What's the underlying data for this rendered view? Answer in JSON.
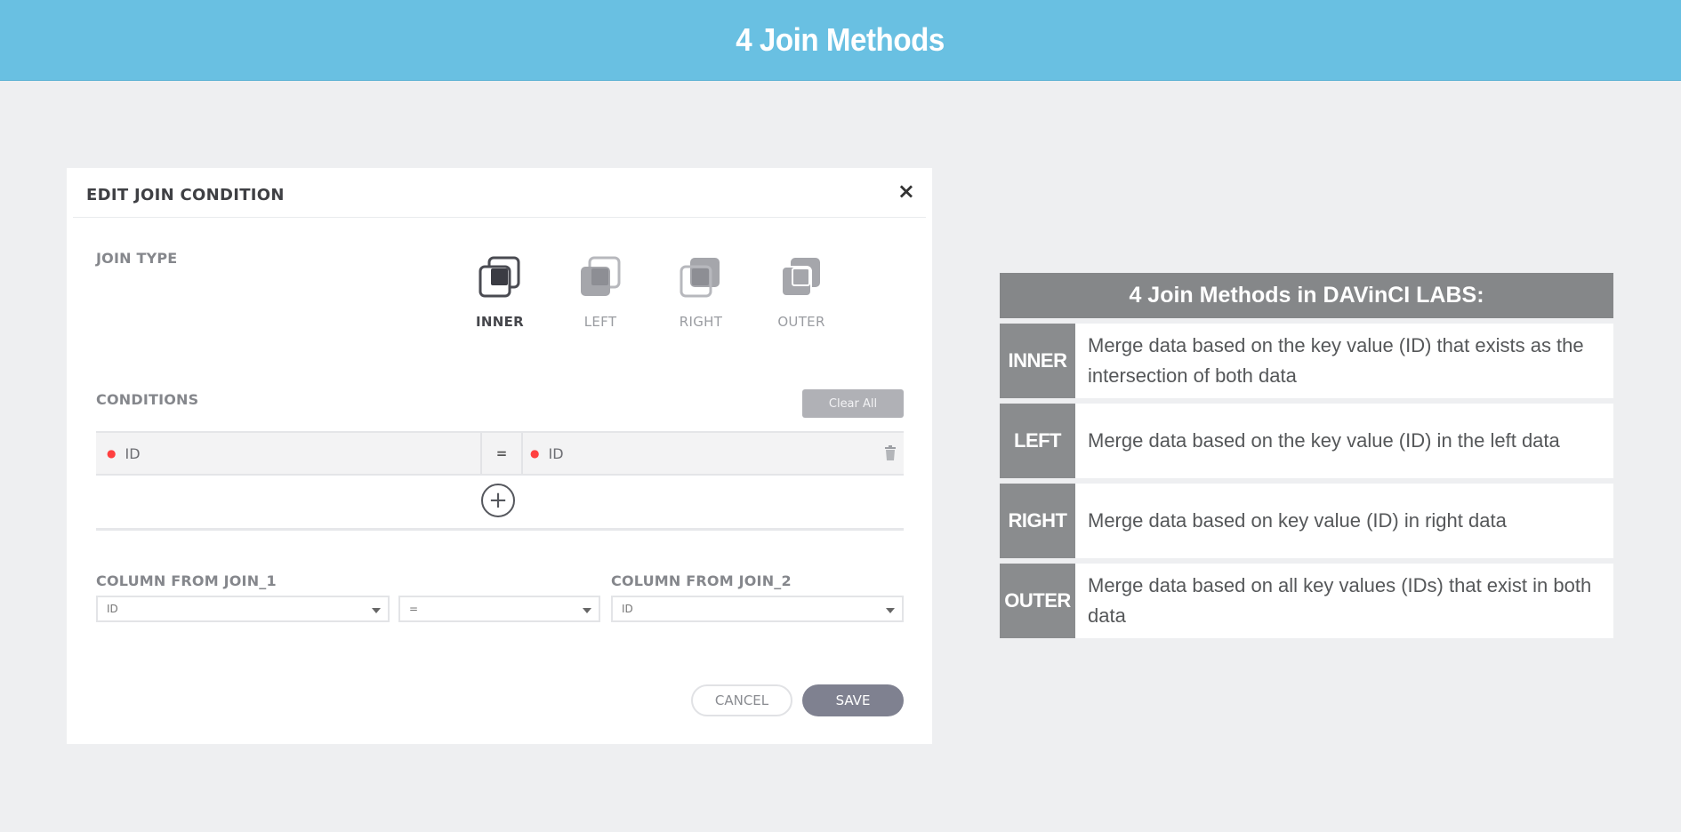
{
  "banner": {
    "title": "4 Join Methods"
  },
  "dialog": {
    "title": "EDIT JOIN CONDITION",
    "close_glyph": "×",
    "join_type_label": "JOIN TYPE",
    "join_options": [
      {
        "label": "INNER",
        "icon": "inner-join-icon",
        "selected": true
      },
      {
        "label": "LEFT",
        "icon": "left-join-icon",
        "selected": false
      },
      {
        "label": "RIGHT",
        "icon": "right-join-icon",
        "selected": false
      },
      {
        "label": "OUTER",
        "icon": "outer-join-icon",
        "selected": false
      }
    ],
    "conditions_label": "CONDITIONS",
    "clear_all_label": "Clear All",
    "condition": {
      "left": "ID",
      "operator": "=",
      "right": "ID"
    },
    "add_glyph": "+",
    "column_join_1_label": "COLUMN FROM JOIN_1",
    "column_join_2_label": "COLUMN FROM JOIN_2",
    "select_join_1": "ID",
    "select_operator": "=",
    "select_join_2": "ID",
    "cancel_label": "CANCEL",
    "save_label": "SAVE"
  },
  "info_table": {
    "title": "4 Join Methods in DAVinCI LABS:",
    "rows": [
      {
        "key": "INNER",
        "desc": "Merge data based on the key value (ID) that exists as the intersection of both data"
      },
      {
        "key": "LEFT",
        "desc": "Merge data based on the key value (ID) in the left data"
      },
      {
        "key": "RIGHT",
        "desc": "Merge data based on key value (ID) in right data"
      },
      {
        "key": "OUTER",
        "desc": "Merge data based on all key values (IDs) that exist in both data"
      }
    ]
  },
  "colors": {
    "banner": "#69c0e2",
    "save_button": "#7f8190",
    "info_header": "#858789",
    "required_dot": "#ff4040"
  }
}
